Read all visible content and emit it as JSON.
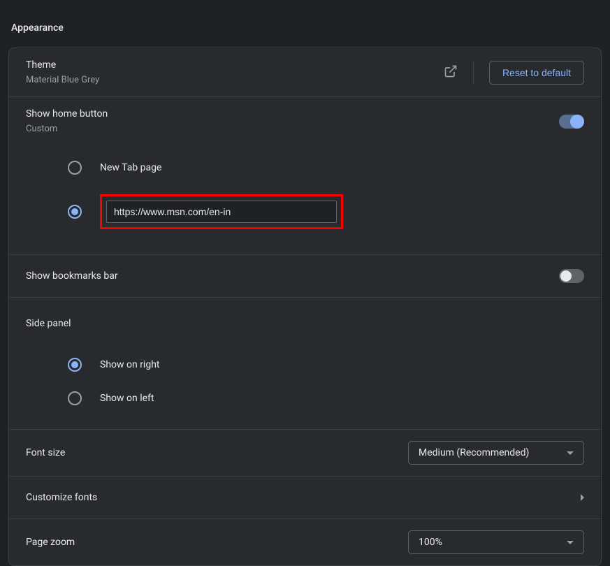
{
  "section_title": "Appearance",
  "theme": {
    "title": "Theme",
    "subtitle": "Material Blue Grey",
    "reset_label": "Reset to default"
  },
  "home": {
    "title": "Show home button",
    "subtitle": "Custom",
    "toggle_on": true,
    "option_newtab": "New Tab page",
    "custom_url_value": "https://www.msn.com/en-in"
  },
  "bookmarks": {
    "title": "Show bookmarks bar",
    "toggle_on": false
  },
  "side_panel": {
    "title": "Side panel",
    "option_right": "Show on right",
    "option_left": "Show on left"
  },
  "font_size": {
    "title": "Font size",
    "selected": "Medium (Recommended)"
  },
  "customize_fonts": {
    "title": "Customize fonts"
  },
  "page_zoom": {
    "title": "Page zoom",
    "selected": "100%"
  }
}
